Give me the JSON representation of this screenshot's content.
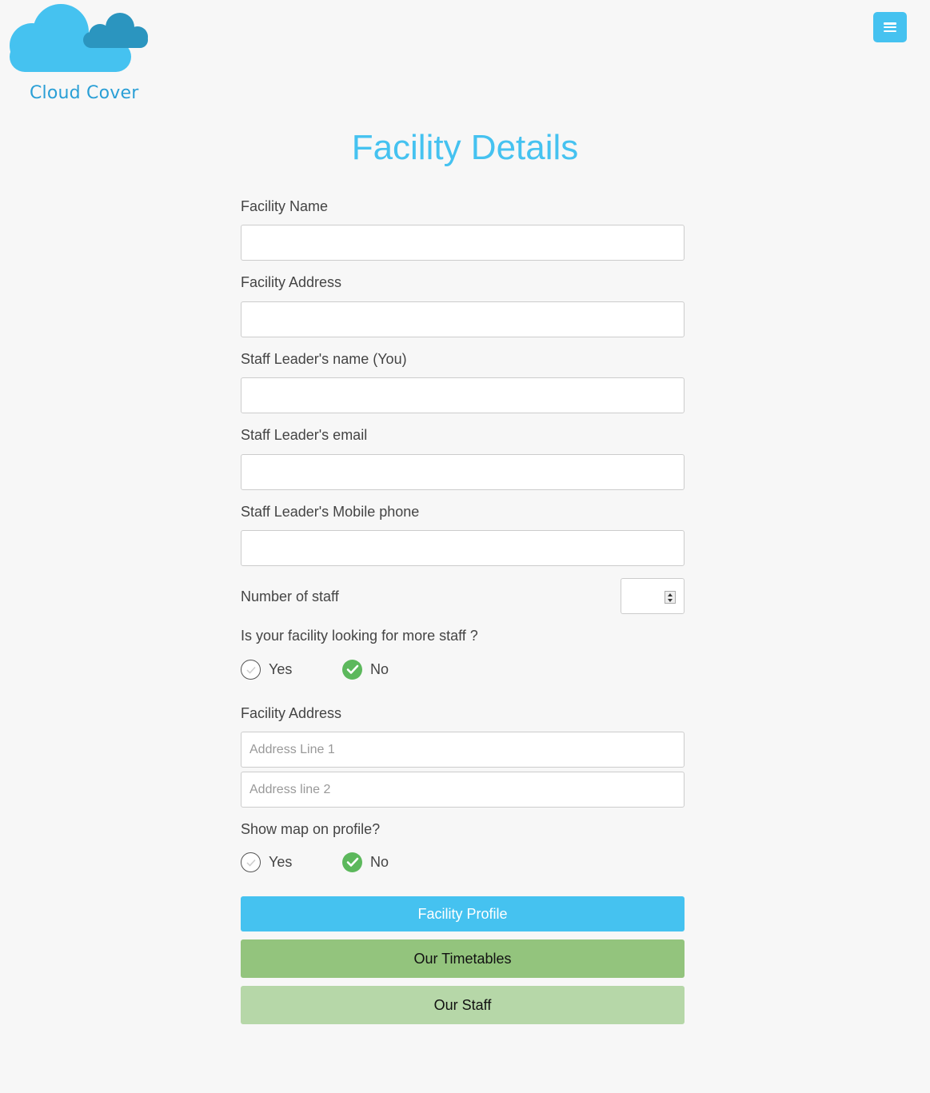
{
  "brand": {
    "name": "Cloud Cover"
  },
  "colors": {
    "accent": "#45c2f0",
    "logo_light": "#45c2f0",
    "logo_dark": "#2b95bf",
    "radio_checked": "#5cb85c",
    "timetables_button": "#93c47d",
    "staff_button": "#b6d7a8"
  },
  "header": {
    "menu_icon": "hamburger-menu-icon"
  },
  "page": {
    "title": "Facility Details"
  },
  "form": {
    "facility_name": {
      "label": "Facility Name",
      "value": ""
    },
    "facility_address": {
      "label": "Facility Address",
      "value": ""
    },
    "leader_name": {
      "label": "Staff Leader's name (You)",
      "value": ""
    },
    "leader_email": {
      "label": "Staff Leader's email",
      "value": ""
    },
    "leader_phone": {
      "label": "Staff Leader's Mobile phone",
      "value": ""
    },
    "staff_count": {
      "label": "Number of staff",
      "value": ""
    },
    "looking_for_staff": {
      "question": "Is your facility looking for more staff ?",
      "options": [
        "Yes",
        "No"
      ],
      "selected": "No"
    },
    "address_block": {
      "label": "Facility Address",
      "line1_placeholder": "Address Line 1",
      "line2_placeholder": "Address line 2"
    },
    "show_map": {
      "question": "Show map on profile?",
      "options": [
        "Yes",
        "No"
      ],
      "selected": "No"
    }
  },
  "buttons": {
    "facility_profile": "Facility Profile",
    "timetables": "Our Timetables",
    "staff": "Our Staff"
  }
}
